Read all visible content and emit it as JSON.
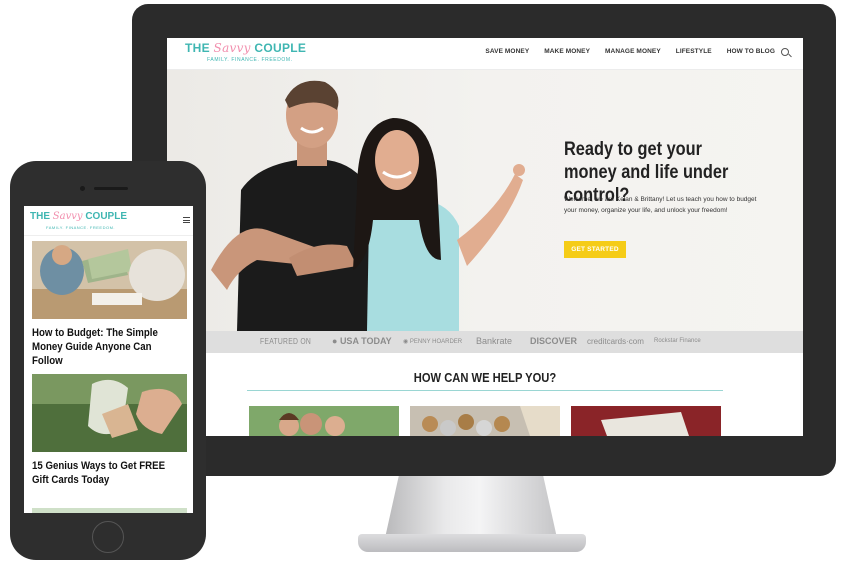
{
  "desktop": {
    "logo": {
      "main_left": "THE ",
      "script": "Savvy",
      "main_right": " COUPLE",
      "tagline": "FAMILY. FINANCE. FREEDOM."
    },
    "nav": [
      "SAVE MONEY",
      "MAKE MONEY",
      "MANAGE MONEY",
      "LIFESTYLE",
      "HOW TO BLOG"
    ],
    "hero": {
      "title": "Ready to get your money and life under control?",
      "text": "Welcome, we are Kelan & Brittany! Let us teach you how to budget your money, organize your life, and unlock your freedom!",
      "button": "GET STARTED"
    },
    "featured": {
      "label": "FEATURED ON",
      "logos": [
        "USA TODAY",
        "PENNY HOARDER",
        "Bankrate",
        "DISCOVER",
        "creditcards·com",
        "Rockstar Finance"
      ]
    },
    "help_heading": "HOW CAN WE HELP YOU?"
  },
  "mobile": {
    "logo": {
      "main_left": "THE ",
      "script": "Savvy",
      "main_right": " COUPLE",
      "tagline": "FAMILY. FINANCE. FREEDOM."
    },
    "posts": [
      {
        "title": "How to Budget: The Simple Money Guide Anyone Can Follow"
      },
      {
        "title": "15 Genius Ways to Get FREE Gift Cards Today"
      }
    ]
  },
  "colors": {
    "brand_teal": "#3fb6b2",
    "brand_pink": "#f28fae",
    "cta_yellow": "#f5cc17",
    "device_frame": "#2b2b2b"
  }
}
